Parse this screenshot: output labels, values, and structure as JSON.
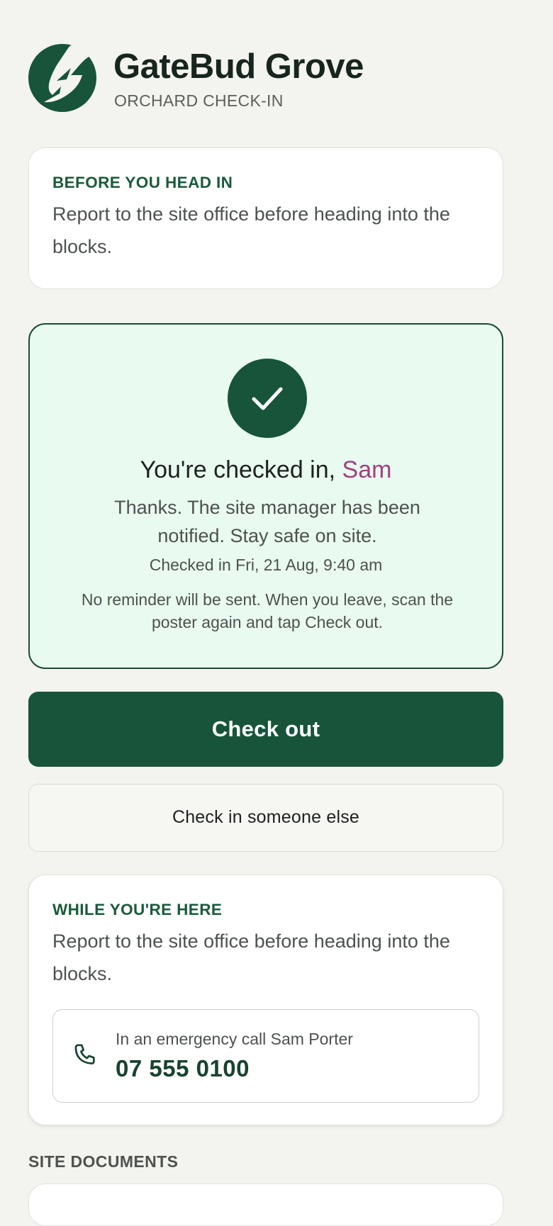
{
  "brand": {
    "title": "GateBud Grove",
    "subtitle": "ORCHARD CHECK-IN",
    "accent_color": "#17543a",
    "logo_icon": "gatebud-leaf-logo"
  },
  "before_card": {
    "eyebrow": "BEFORE YOU HEAD IN",
    "text": "Report to the site office before heading into the blocks."
  },
  "success": {
    "icon": "checkmark-icon",
    "title_prefix": "You're checked in, ",
    "name": "Sam",
    "name_color": "#a2407f",
    "message": "Thanks. The site manager has been notified. Stay safe on site.",
    "timestamp": "Checked in Fri, 21 Aug, 9:40 am",
    "note": "No reminder will be sent. When you leave, scan the poster again and tap Check out."
  },
  "actions": {
    "checkout_label": "Check out",
    "checkin_other_label": "Check in someone else"
  },
  "while_card": {
    "eyebrow": "WHILE YOU'RE HERE",
    "text": "Report to the site office before heading into the blocks.",
    "emergency": {
      "icon": "phone-icon",
      "label": "In an emergency call Sam Porter",
      "number": "07 555 0100"
    }
  },
  "documents": {
    "heading": "SITE DOCUMENTS"
  }
}
